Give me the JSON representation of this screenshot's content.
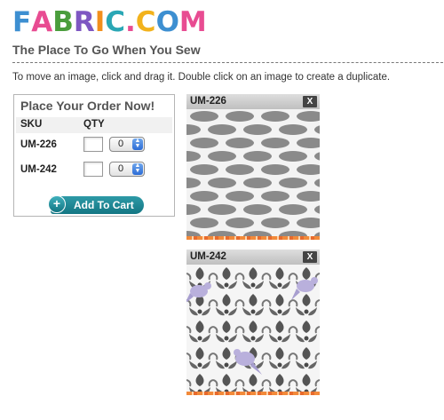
{
  "logo": {
    "letters": [
      "F",
      "A",
      "B",
      "R",
      "I",
      "C",
      ".",
      "C",
      "O",
      "M"
    ],
    "colors": [
      "#3d8fd1",
      "#e84c92",
      "#4a9d3c",
      "#7e57c2",
      "#f28f1c",
      "#2aa7b5",
      "#e84c92",
      "#f2b21c",
      "#3d8fd1",
      "#e84c92"
    ]
  },
  "tagline": "The Place To Go When You Sew",
  "instructions": "To move an image, click and drag it. Double click on an image to create a duplicate.",
  "order": {
    "title": "Place Your Order Now!",
    "col_sku": "SKU",
    "col_qty": "QTY",
    "rows": [
      {
        "sku": "UM-226",
        "qty_value": "",
        "qty_select": "0"
      },
      {
        "sku": "UM-242",
        "qty_value": "",
        "qty_select": "0"
      }
    ],
    "add_button": "Add To Cart"
  },
  "swatches": [
    {
      "sku": "UM-226",
      "close": "X",
      "pattern": "grey ikat ovals on white"
    },
    {
      "sku": "UM-242",
      "close": "X",
      "pattern": "grey floral damask with lavender birds"
    }
  ]
}
